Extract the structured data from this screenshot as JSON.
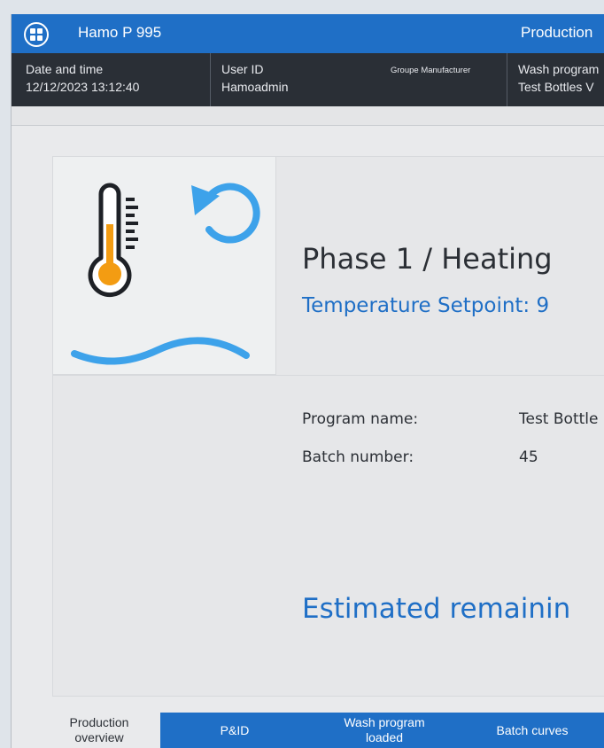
{
  "header": {
    "app_title": "Hamo P 995",
    "mode_title": "Production"
  },
  "infobar": {
    "datetime_label": "Date and time",
    "datetime_value": "12/12/2023 13:12:40",
    "user_label": "User ID",
    "user_value": "Hamoadmin",
    "group_label": "Groupe Manufacturer",
    "wash_label": "Wash program",
    "wash_value": "Test Bottles V"
  },
  "main": {
    "phase_title": "Phase 1 / Heating",
    "setpoint_text": "Temperature Setpoint: 9",
    "program_name_label": "Program name:",
    "program_name_value": "Test Bottle",
    "batch_number_label": "Batch number:",
    "batch_number_value": "45",
    "estimated_text": "Estimated remainin"
  },
  "icons": {
    "thermometer": "thermometer-icon",
    "rotate": "rotate-icon",
    "wave": "wave-icon",
    "logo": "logo-icon"
  },
  "colors": {
    "accent": "#1f6fc6",
    "thermo_fill": "#f39c12",
    "wave": "#3da2ea"
  },
  "nav": {
    "tabs": [
      {
        "label_line1": "Production",
        "label_line2": "overview"
      },
      {
        "label": "P&ID"
      },
      {
        "label_line1": "Wash program",
        "label_line2": "loaded"
      },
      {
        "label": "Batch curves"
      }
    ]
  }
}
